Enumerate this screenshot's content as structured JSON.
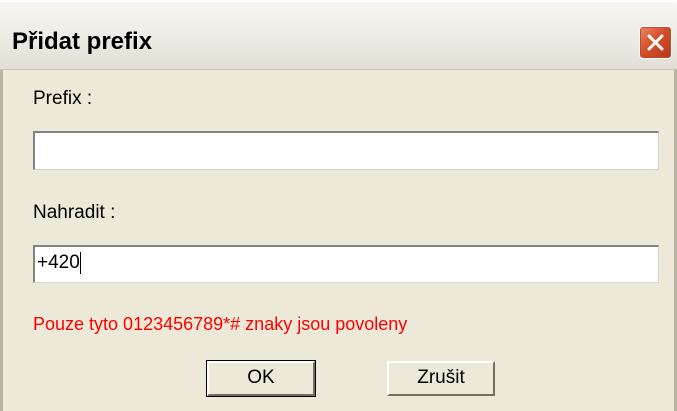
{
  "dialog": {
    "title": "Přidat prefix",
    "close_icon": "close-icon"
  },
  "form": {
    "prefix_label": "Prefix :",
    "prefix_value": "",
    "replace_label": "Nahradit :",
    "replace_value": "+420"
  },
  "validation": {
    "message": "Pouze tyto 0123456789*# znaky jsou povoleny",
    "color": "#ff0000"
  },
  "buttons": {
    "ok_label": "OK",
    "cancel_label": "Zrušit"
  },
  "colors": {
    "window_bg": "#ece9d8",
    "close_button": "#d4502a"
  }
}
